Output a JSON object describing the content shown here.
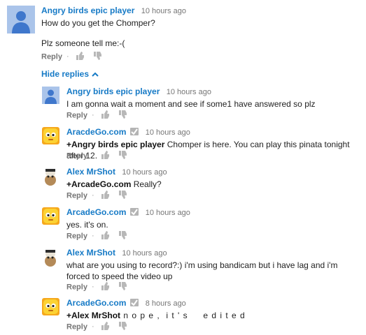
{
  "top_comment": {
    "author": "Angry birds epic player",
    "time": "10 hours ago",
    "line1": "How do you get the Chomper?",
    "line2": "Plz someone tell me:-(",
    "reply_label": "Reply",
    "dot": "·"
  },
  "hide_replies_label": "Hide replies",
  "replies": [
    {
      "author": "Angry birds epic player",
      "time": "10 hours ago",
      "text": "I am gonna wait a moment and see if some1 have answered so plz",
      "reply_label": "Reply"
    },
    {
      "author": "AracdeGo.com",
      "time": "10 hours ago",
      "mention": "+Angry birds epic player",
      "text": " Chomper is here. You can play this pinata tonight after 12.",
      "reply_label": "Reply"
    },
    {
      "author": "Alex MrShot",
      "time": "10 hours ago",
      "mention": "+ArcadeGo.com",
      "text": " Really?",
      "reply_label": "Reply"
    },
    {
      "author": "ArcadeGo.com",
      "time": "10 hours ago",
      "text": "yes. it's on.",
      "reply_label": "Reply"
    },
    {
      "author": "Alex MrShot",
      "time": "10 hours ago",
      "text": "what are you using to record?:) i'm using bandicam but i have lag and i'm forced to speed the video up",
      "reply_label": "Reply"
    },
    {
      "author": "ArcadeGo.com",
      "time": "8 hours ago",
      "mention": "+Alex MrShot",
      "text": " n o p e ,  i t ' s     e d i t e d",
      "reply_label": "Reply"
    }
  ]
}
